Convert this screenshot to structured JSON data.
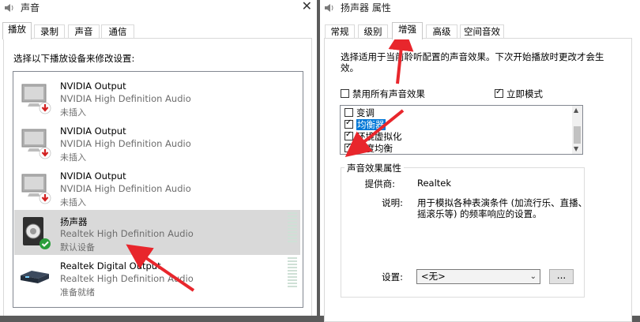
{
  "left_window": {
    "title": "声音",
    "tabs": [
      {
        "label": "播放",
        "active": true
      },
      {
        "label": "录制"
      },
      {
        "label": "声音"
      },
      {
        "label": "通信"
      }
    ],
    "instruction": "选择以下播放设备来修改设置:",
    "devices": [
      {
        "name": "NVIDIA Output",
        "driver": "NVIDIA High Definition Audio",
        "status": "未插入",
        "icon": "monitor-icon",
        "badge": "unplugged-red-arrow"
      },
      {
        "name": "NVIDIA Output",
        "driver": "NVIDIA High Definition Audio",
        "status": "未插入",
        "icon": "monitor-icon",
        "badge": "unplugged-red-arrow"
      },
      {
        "name": "NVIDIA Output",
        "driver": "NVIDIA High Definition Audio",
        "status": "未插入",
        "icon": "monitor-icon",
        "badge": "unplugged-red-arrow"
      },
      {
        "name": "扬声器",
        "driver": "Realtek High Definition Audio",
        "status": "默认设备",
        "icon": "speaker-icon",
        "badge": "default-green-check",
        "selected": true
      },
      {
        "name": "Realtek Digital Output",
        "driver": "Realtek High Definition Audio",
        "status": "准备就绪",
        "icon": "digital-output-icon"
      }
    ]
  },
  "right_window": {
    "title": "扬声器 属性",
    "tabs": [
      {
        "label": "常规"
      },
      {
        "label": "级别"
      },
      {
        "label": "增强",
        "active": true
      },
      {
        "label": "高级"
      },
      {
        "label": "空间音效"
      }
    ],
    "instruction_line1": "选择适用于当前聆听配置的声音效果。下次开始播放时更改才会生",
    "instruction_line2": "效。",
    "disable_all": {
      "label": "禁用所有声音效果",
      "checked": false
    },
    "immediate_mode": {
      "label": "立即模式",
      "checked": true
    },
    "effects": [
      {
        "label": "变调",
        "checked": false
      },
      {
        "label": "均衡器",
        "checked": true,
        "highlighted": true
      },
      {
        "label": "环境虚拟化",
        "checked": true
      },
      {
        "label": "响度均衡",
        "checked": true
      }
    ],
    "properties_group": "声音效果属性",
    "provider_label": "提供商:",
    "provider_value": "Realtek",
    "description_label": "说明:",
    "description_line1": "用于模拟各种表演条件 (加流行乐、直播、",
    "description_line2": "摇滚乐等) 的频率响应的设置。",
    "settings_label": "设置:",
    "settings_value": "<无>",
    "more_button": "..."
  },
  "colors": {
    "accent": "#0078d7",
    "annotation_arrow": "#e8262c",
    "selection": "#d9d9d9",
    "default_check": "#2a9d3a"
  }
}
